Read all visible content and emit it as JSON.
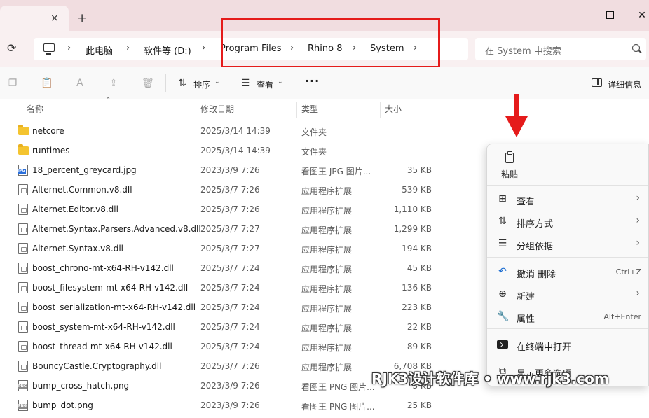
{
  "window": {
    "tab_close_glyph": "×",
    "new_tab_glyph": "+",
    "close_glyph": "✕"
  },
  "address": {
    "crumbs": [
      "此电脑",
      "软件等 (D:)",
      "Program Files",
      "Rhino 8",
      "System"
    ],
    "separator": "›",
    "search_placeholder": "在 System 中搜索"
  },
  "toolbar": {
    "sort_label": "排序",
    "view_label": "查看",
    "more_glyph": "···",
    "details_label": "详细信息"
  },
  "columns": {
    "name": "名称",
    "date": "修改日期",
    "type": "类型",
    "size": "大小"
  },
  "files": [
    {
      "name": "netcore",
      "date": "2025/3/14 14:39",
      "type": "文件夹",
      "size": "",
      "icon": "folder-icon"
    },
    {
      "name": "runtimes",
      "date": "2025/3/14 14:39",
      "type": "文件夹",
      "size": "",
      "icon": "folder-icon"
    },
    {
      "name": "18_percent_greycard.jpg",
      "date": "2023/3/9 7:26",
      "type": "看图王 JPG 图片...",
      "size": "35 KB",
      "icon": "jpg-file-icon"
    },
    {
      "name": "Alternet.Common.v8.dll",
      "date": "2025/3/7 7:26",
      "type": "应用程序扩展",
      "size": "539 KB",
      "icon": "dll-file-icon"
    },
    {
      "name": "Alternet.Editor.v8.dll",
      "date": "2025/3/7 7:26",
      "type": "应用程序扩展",
      "size": "1,110 KB",
      "icon": "dll-file-icon"
    },
    {
      "name": "Alternet.Syntax.Parsers.Advanced.v8.dll",
      "date": "2025/3/7 7:27",
      "type": "应用程序扩展",
      "size": "1,299 KB",
      "icon": "dll-file-icon"
    },
    {
      "name": "Alternet.Syntax.v8.dll",
      "date": "2025/3/7 7:27",
      "type": "应用程序扩展",
      "size": "194 KB",
      "icon": "dll-file-icon"
    },
    {
      "name": "boost_chrono-mt-x64-RH-v142.dll",
      "date": "2025/3/7 7:24",
      "type": "应用程序扩展",
      "size": "45 KB",
      "icon": "dll-file-icon"
    },
    {
      "name": "boost_filesystem-mt-x64-RH-v142.dll",
      "date": "2025/3/7 7:24",
      "type": "应用程序扩展",
      "size": "136 KB",
      "icon": "dll-file-icon"
    },
    {
      "name": "boost_serialization-mt-x64-RH-v142.dll",
      "date": "2025/3/7 7:24",
      "type": "应用程序扩展",
      "size": "223 KB",
      "icon": "dll-file-icon"
    },
    {
      "name": "boost_system-mt-x64-RH-v142.dll",
      "date": "2025/3/7 7:24",
      "type": "应用程序扩展",
      "size": "22 KB",
      "icon": "dll-file-icon"
    },
    {
      "name": "boost_thread-mt-x64-RH-v142.dll",
      "date": "2025/3/7 7:24",
      "type": "应用程序扩展",
      "size": "89 KB",
      "icon": "dll-file-icon"
    },
    {
      "name": "BouncyCastle.Cryptography.dll",
      "date": "2025/3/7 7:26",
      "type": "应用程序扩展",
      "size": "6,708 KB",
      "icon": "dll-file-icon"
    },
    {
      "name": "bump_cross_hatch.png",
      "date": "2023/3/9 7:26",
      "type": "看图王 PNG 图片...",
      "size": "3 KB",
      "icon": "png-file-icon"
    },
    {
      "name": "bump_dot.png",
      "date": "2023/3/9 7:26",
      "type": "看图王 PNG 图片...",
      "size": "25 KB",
      "icon": "png-file-icon"
    }
  ],
  "context_menu": {
    "paste_label": "粘贴",
    "items": [
      {
        "label": "查看",
        "shortcut": "",
        "submenu": true,
        "icon": "grid-icon",
        "glyph": "⊞"
      },
      {
        "label": "排序方式",
        "shortcut": "",
        "submenu": true,
        "icon": "sort-icon",
        "glyph": "⇅"
      },
      {
        "label": "分组依据",
        "shortcut": "",
        "submenu": true,
        "icon": "group-icon",
        "glyph": "☰"
      },
      {
        "label": "撤消 删除",
        "shortcut": "Ctrl+Z",
        "submenu": false,
        "icon": "undo-icon",
        "glyph": "↶"
      },
      {
        "label": "新建",
        "shortcut": "",
        "submenu": true,
        "icon": "new-icon",
        "glyph": "⊕"
      },
      {
        "label": "属性",
        "shortcut": "Alt+Enter",
        "submenu": false,
        "icon": "wrench-icon",
        "glyph": "🔧"
      },
      {
        "label": "在终端中打开",
        "shortcut": "",
        "submenu": false,
        "icon": "terminal-icon",
        "glyph": ""
      },
      {
        "label": "显示更多选项",
        "shortcut": "",
        "submenu": false,
        "icon": "more-options-icon",
        "glyph": "⧉"
      }
    ],
    "submenu_glyph": "›"
  },
  "watermark": "RJK3设计软件库 • www.rjk3.com",
  "colors": {
    "accent": "#1f6fd1",
    "annotation_red": "#e51b1b",
    "titlebar": "#f1dde0",
    "folder": "#f4c430"
  }
}
